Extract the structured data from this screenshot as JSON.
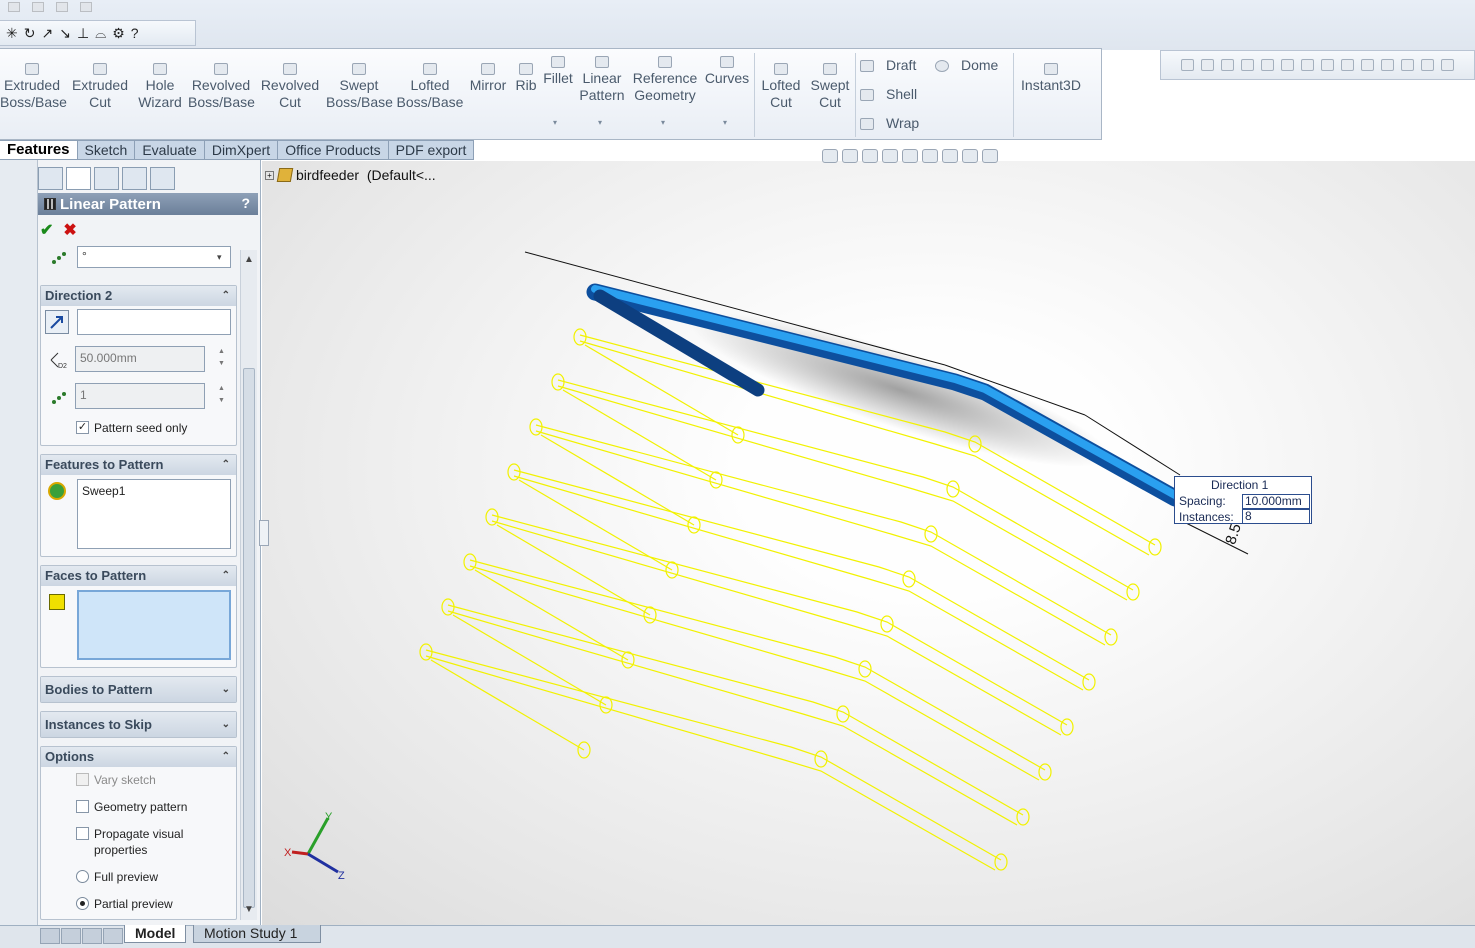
{
  "ribbon": {
    "buttons": [
      {
        "label": "Extruded\nBoss/Base",
        "icon": "extruded-boss-icon"
      },
      {
        "label": "Extruded\nCut",
        "icon": "extruded-cut-icon"
      },
      {
        "label": "Hole\nWizard",
        "icon": "hole-wizard-icon"
      },
      {
        "label": "Revolved\nBoss/Base",
        "icon": "revolved-boss-icon"
      },
      {
        "label": "Revolved\nCut",
        "icon": "revolved-cut-icon"
      },
      {
        "label": "Swept\nBoss/Base",
        "icon": "swept-boss-icon"
      },
      {
        "label": "Lofted\nBoss/Base",
        "icon": "lofted-boss-icon"
      },
      {
        "label": "Mirror",
        "icon": "mirror-icon"
      },
      {
        "label": "Rib",
        "icon": "rib-icon"
      },
      {
        "label": "Fillet",
        "icon": "fillet-icon"
      },
      {
        "label": "Linear\nPattern",
        "icon": "linear-pattern-icon"
      },
      {
        "label": "Reference\nGeometry",
        "icon": "reference-geometry-icon"
      },
      {
        "label": "Curves",
        "icon": "curves-icon"
      },
      {
        "label": "Lofted\nCut",
        "icon": "lofted-cut-icon"
      },
      {
        "label": "Swept\nCut",
        "icon": "swept-cut-icon"
      },
      {
        "label": "Instant3D",
        "icon": "instant3d-icon"
      }
    ],
    "small": {
      "draft": "Draft",
      "dome": "Dome",
      "shell": "Shell",
      "wrap": "Wrap"
    }
  },
  "tabs": [
    "Features",
    "Sketch",
    "Evaluate",
    "DimXpert",
    "Office Products",
    "PDF export"
  ],
  "tree": {
    "root": "birdfeeder  (Default<..."
  },
  "pm": {
    "title": "Linear Pattern",
    "help": "?",
    "ok": "✔",
    "cancel": "✖",
    "dir1_instances_field": "°",
    "direction2": {
      "header": "Direction 2",
      "direction_value": "",
      "spacing": "50.000mm",
      "instances": "1",
      "seed_only": "Pattern seed only",
      "seed_only_checked": true
    },
    "features": {
      "header": "Features to Pattern",
      "items": [
        "Sweep1"
      ]
    },
    "faces": {
      "header": "Faces to Pattern"
    },
    "bodies": {
      "header": "Bodies to Pattern"
    },
    "skip": {
      "header": "Instances to Skip"
    },
    "options": {
      "header": "Options",
      "vary": "Vary sketch",
      "geom": "Geometry pattern",
      "propagate": "Propagate visual properties",
      "full": "Full preview",
      "partial": "Partial preview",
      "selected_preview": "partial"
    }
  },
  "callout": {
    "title": "Direction 1",
    "spacing_label": "Spacing:",
    "spacing_value": "10.000mm",
    "instances_label": "Instances:",
    "instances_value": "8",
    "dim_text": "8.500"
  },
  "triad": {
    "x": "X",
    "y": "Y",
    "z": "Z"
  },
  "bottom": {
    "tabs": [
      "Model",
      "Motion Study 1"
    ]
  },
  "colors": {
    "preview": "#f2f200",
    "body": "#1a8be0",
    "body_dark": "#0d4f9e",
    "titlebar": "#7588a1"
  }
}
